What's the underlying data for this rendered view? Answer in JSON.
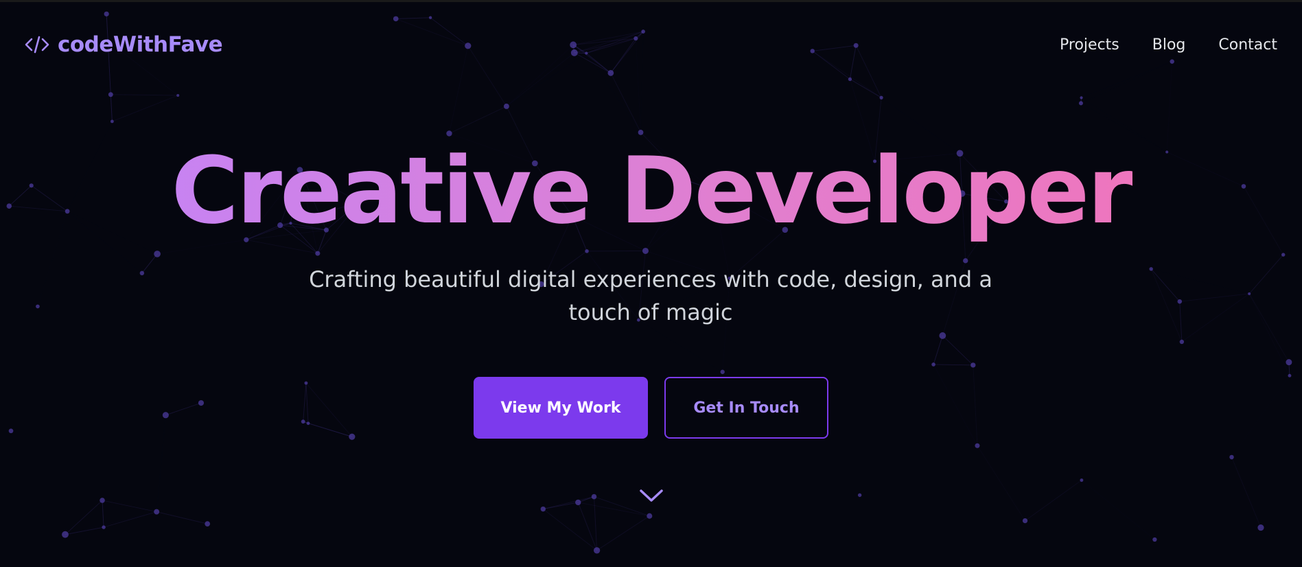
{
  "brand": {
    "logo_icon": "code-brackets-icon",
    "name": "codeWithFave"
  },
  "nav": {
    "items": [
      {
        "label": "Projects"
      },
      {
        "label": "Blog"
      },
      {
        "label": "Contact"
      }
    ]
  },
  "hero": {
    "title": "Creative Developer",
    "subtitle": "Crafting beautiful digital experiences with code, design, and a touch of magic",
    "primary_button": "View My Work",
    "secondary_button": "Get In Touch",
    "scroll_icon": "chevron-down-icon"
  },
  "colors": {
    "background": "#05060f",
    "accent": "#7c3aed",
    "accent_light": "#a78bfa",
    "gradient_start": "#c084fc",
    "gradient_end": "#f472b6",
    "nav_text": "#e5e7eb",
    "subtitle_text": "#d1d5db",
    "particle": "#4c3b9e"
  }
}
